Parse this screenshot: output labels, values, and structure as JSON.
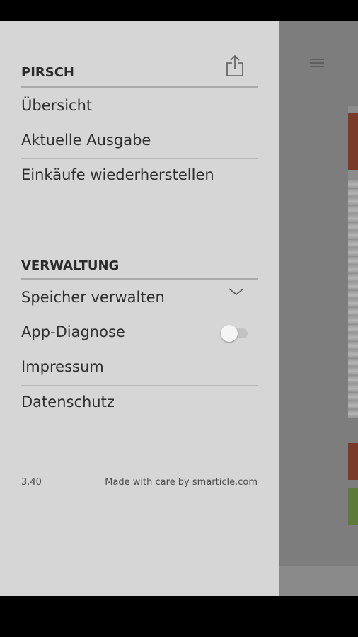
{
  "drawer": {
    "section_pirsch": {
      "title": "PIRSCH",
      "items": [
        "Übersicht",
        "Aktuelle Ausgabe",
        "Einkäufe wiederherstellen"
      ]
    },
    "section_verwaltung": {
      "title": "VERWALTUNG",
      "items": [
        "Speicher verwalten",
        "App-Diagnose",
        "Impressum",
        "Datenschutz"
      ]
    },
    "app_diagnose_enabled": false,
    "footer": {
      "version": "3.40",
      "credit": "Made with care by smarticle.com"
    }
  },
  "icons": {
    "share": "share-icon",
    "chevron": "chevron-down-icon",
    "menu": "hamburger-menu-icon"
  },
  "colors": {
    "drawer_bg": "#d6d6d6",
    "scrim": "#7d7d7d",
    "accent_red": "#7a3a2a",
    "accent_green": "#5e7a3a"
  }
}
